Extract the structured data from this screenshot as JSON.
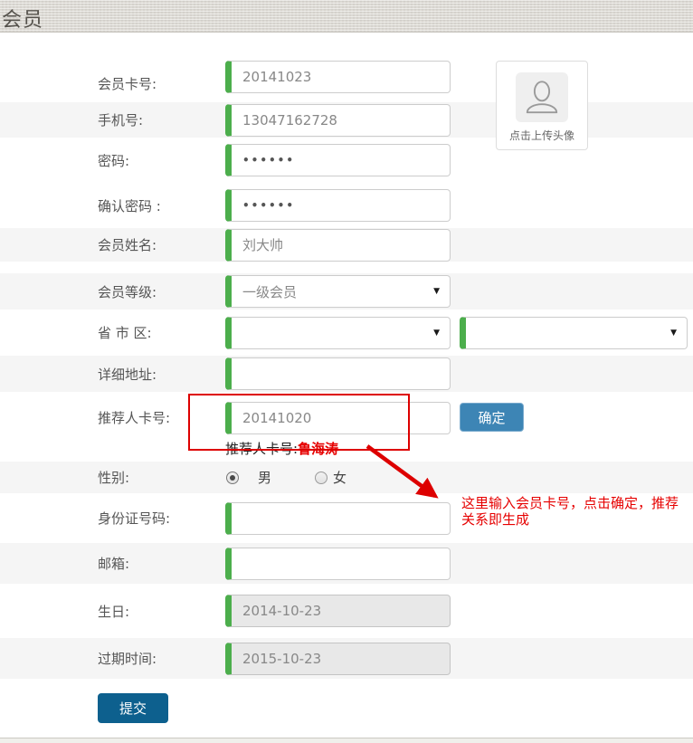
{
  "header": {
    "title": "会员"
  },
  "avatar": {
    "label": "点击上传头像"
  },
  "form": {
    "rows": [
      {
        "key": "card_no",
        "label": "会员卡号:",
        "value": "20141023"
      },
      {
        "key": "phone",
        "label": "手机号:",
        "value": "13047162728"
      },
      {
        "key": "password",
        "label": "密码:",
        "value": "••••••"
      },
      {
        "key": "confirm",
        "label": "确认密码 :",
        "value": "••••••"
      },
      {
        "key": "name",
        "label": "会员姓名:",
        "value": "刘大帅"
      },
      {
        "key": "level",
        "label": "会员等级:",
        "value": "一级会员"
      },
      {
        "key": "region",
        "label": "省 市 区:",
        "value": "",
        "value2": ""
      },
      {
        "key": "address",
        "label": "详细地址:",
        "value": ""
      },
      {
        "key": "referrer",
        "label": "推荐人卡号:",
        "value": "20141020",
        "button_label": "确定",
        "caption_prefix": "推荐人卡号:",
        "caption_value": "鲁海涛"
      },
      {
        "key": "gender",
        "label": "性别:",
        "options": [
          {
            "label": "男",
            "checked": true
          },
          {
            "label": "女",
            "checked": false
          }
        ]
      },
      {
        "key": "id_number",
        "label": "身份证号码:",
        "value": ""
      },
      {
        "key": "email",
        "label": "邮箱:",
        "value": ""
      },
      {
        "key": "birthday",
        "label": "生日:",
        "value": "2014-10-23",
        "disabled": true
      },
      {
        "key": "expiry",
        "label": "过期时间:",
        "value": "2015-10-23",
        "disabled": true
      }
    ],
    "submit_label": "提交"
  },
  "annotation": {
    "note": "这里输入会员卡号，点击确定，推荐关系即生成"
  },
  "colors": {
    "accent_green": "#4cae4c",
    "confirm_button_blue": "#3d85b5",
    "submit_button_blue": "#0d608e",
    "annotation_red": "#e60000",
    "row_stripe_gray": "#f5f5f5",
    "header_gray": "#dbd8d2"
  }
}
